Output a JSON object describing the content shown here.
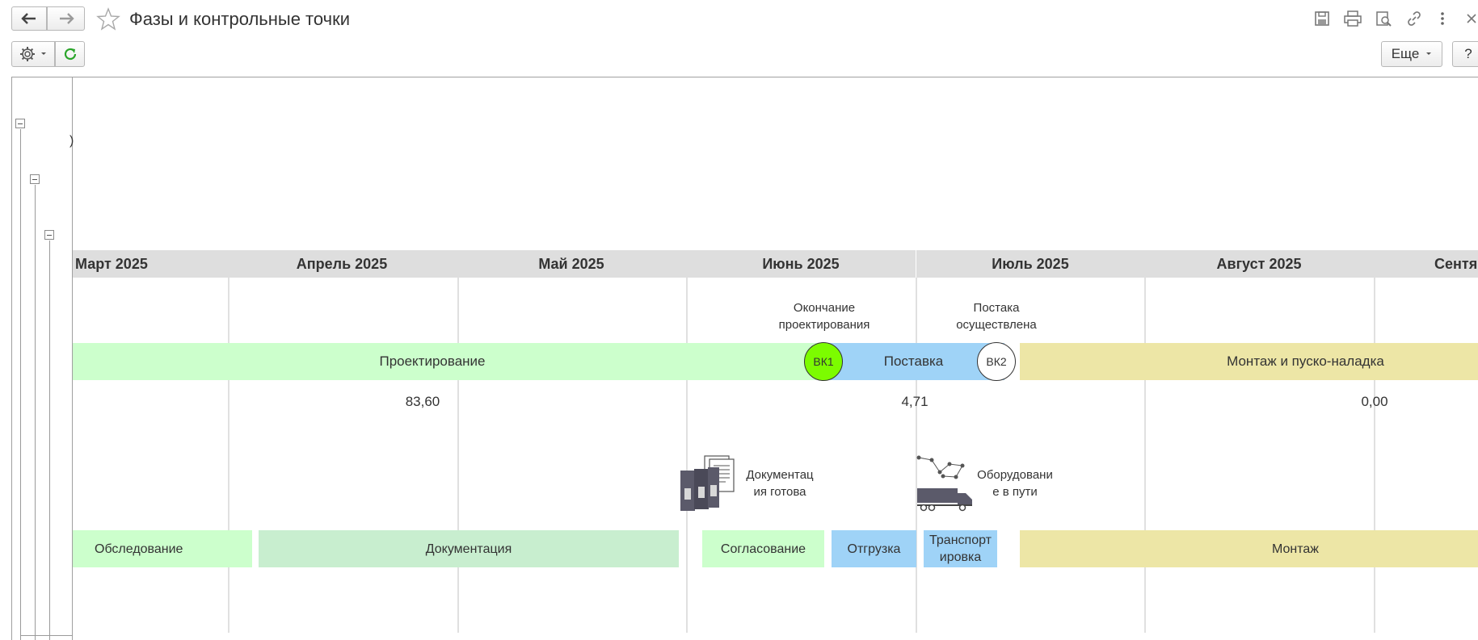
{
  "window": {
    "title": "Фазы и контрольные точки",
    "nav_back_icon": "arrow-left-icon",
    "nav_forward_icon": "arrow-right-icon",
    "favorite_icon": "star-icon",
    "more_label": "Еще",
    "help_label": "?"
  },
  "months": [
    "Март 2025",
    "Апрель 2025",
    "Май 2025",
    "Июнь 2025",
    "Июль 2025",
    "Август 2025",
    "Сентя"
  ],
  "phases": {
    "design": "Проектирование",
    "supply": "Поставка",
    "install": "Монтаж и пуско-наладка"
  },
  "milestones": {
    "vk1": {
      "label": "ВК1",
      "caption_line1": "Окончание",
      "caption_line2": "проектирования",
      "color": "#7cfc00"
    },
    "vk2": {
      "label": "ВК2",
      "caption_line1": "Постака",
      "caption_line2": "осуществлена",
      "color": "#ffffff"
    }
  },
  "values": {
    "design": "83,60",
    "supply": "4,71",
    "install": "0,00"
  },
  "events": {
    "docs": {
      "line1": "Документац",
      "line2": "ия готова",
      "icon": "documents-binders-icon"
    },
    "transit": {
      "line1": "Оборудовани",
      "line2": "е в пути",
      "icon": "truck-route-icon"
    }
  },
  "tasks": {
    "survey": "Обследование",
    "documentation": "Документация",
    "approval": "Согласование",
    "shipment": "Отгрузка",
    "transport_line1": "Транспорт",
    "transport_line2": "ировка",
    "mount": "Монтаж"
  },
  "colors": {
    "design": "#ccffcc",
    "supply": "#9fd3f7",
    "install": "#ede6a6",
    "documentation": "#c8eecf",
    "refresh": "#2aa52a"
  }
}
